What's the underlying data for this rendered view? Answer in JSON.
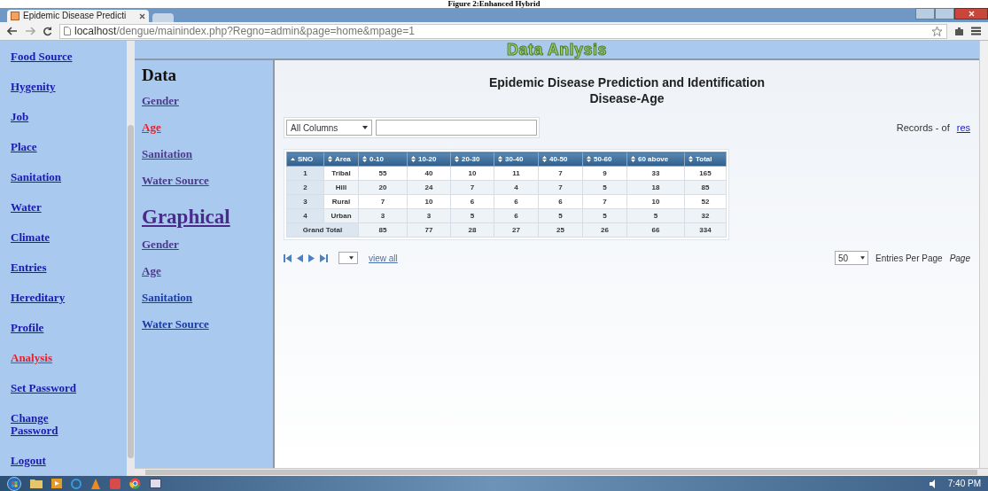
{
  "caption": "Figure 2:Enhanced Hybrid",
  "browser": {
    "tab_title": "Epidemic Disease Predicti",
    "url_host": "localhost",
    "url_path": "/dengue/mainindex.php?Regno=admin&page=home&mpage=1"
  },
  "banner": "Data Anlysis",
  "sidebar": {
    "items": [
      {
        "label": "Food Source",
        "selected": false
      },
      {
        "label": "Hygenity",
        "selected": false
      },
      {
        "label": "Job",
        "selected": false
      },
      {
        "label": "Place",
        "selected": false
      },
      {
        "label": "Sanitation",
        "selected": false
      },
      {
        "label": "Water",
        "selected": false
      },
      {
        "label": "Climate",
        "selected": false
      },
      {
        "label": "Entries",
        "selected": false
      },
      {
        "label": "Hereditary",
        "selected": false
      },
      {
        "label": "Profile",
        "selected": false
      },
      {
        "label": "Analysis",
        "selected": true
      },
      {
        "label": "Set Password",
        "selected": false
      },
      {
        "label": "Change Password",
        "selected": false
      },
      {
        "label": "Logout",
        "selected": false
      }
    ]
  },
  "report_menu": {
    "sections": [
      {
        "heading": "Data",
        "kind": "text",
        "items": [
          {
            "label": "Gender",
            "selected": false,
            "visited": true
          },
          {
            "label": "Age",
            "selected": true,
            "visited": true
          },
          {
            "label": "Sanitation",
            "selected": false,
            "visited": true
          },
          {
            "label": "Water Source",
            "selected": false,
            "visited": true
          }
        ]
      },
      {
        "heading": "Graphical",
        "kind": "link",
        "items": [
          {
            "label": "Gender",
            "selected": false,
            "visited": true
          },
          {
            "label": "Age",
            "selected": false,
            "visited": true
          },
          {
            "label": "Sanitation",
            "selected": false,
            "visited": false
          },
          {
            "label": "Water Source",
            "selected": false,
            "visited": false
          }
        ]
      }
    ]
  },
  "report": {
    "title": "Epidemic Disease Prediction and Identification",
    "subtitle": "Disease-Age",
    "filter": {
      "column": "All Columns"
    },
    "records_text": "Records - of",
    "reset_link": "res",
    "table": {
      "columns": [
        {
          "label": "SNO",
          "sorted": true
        },
        {
          "label": "Area",
          "sorted": false
        },
        {
          "label": "0-10",
          "sorted": false
        },
        {
          "label": "10-20",
          "sorted": false
        },
        {
          "label": "20-30",
          "sorted": false
        },
        {
          "label": "30-40",
          "sorted": false
        },
        {
          "label": "40-50",
          "sorted": false
        },
        {
          "label": "50-60",
          "sorted": false
        },
        {
          "label": "60 above",
          "sorted": false
        },
        {
          "label": "Total",
          "sorted": false
        }
      ],
      "rows": [
        [
          "1",
          "Tribal",
          "55",
          "40",
          "10",
          "11",
          "7",
          "9",
          "33",
          "165"
        ],
        [
          "2",
          "Hill",
          "20",
          "24",
          "7",
          "4",
          "7",
          "5",
          "18",
          "85"
        ],
        [
          "3",
          "Rural",
          "7",
          "10",
          "6",
          "6",
          "6",
          "7",
          "10",
          "52"
        ],
        [
          "4",
          "Urban",
          "3",
          "3",
          "5",
          "6",
          "5",
          "5",
          "5",
          "32"
        ]
      ],
      "footer": {
        "label": "Grand Total",
        "values": [
          "85",
          "77",
          "28",
          "27",
          "25",
          "26",
          "66",
          "334"
        ]
      }
    },
    "pager": {
      "view_all": "view all",
      "per_page": "50",
      "per_page_label": "Entries Per Page",
      "page_label": "Page"
    }
  },
  "taskbar": {
    "time": "7:40 PM"
  }
}
